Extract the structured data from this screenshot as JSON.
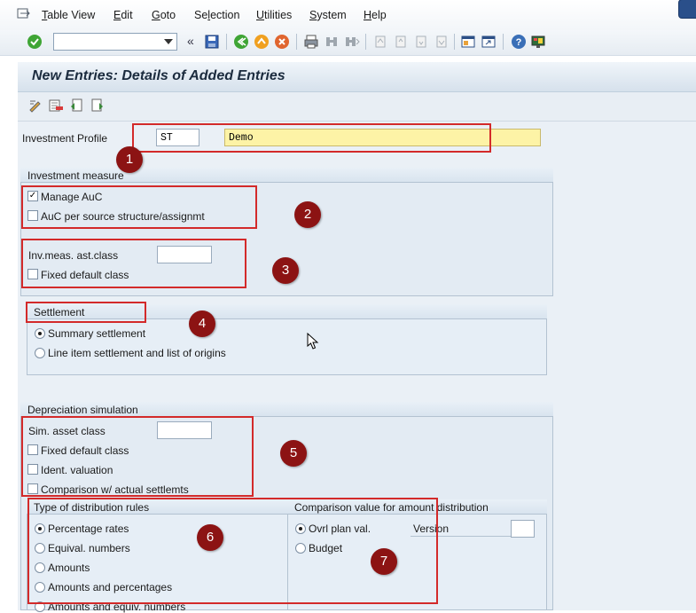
{
  "menu": {
    "items": [
      {
        "label": "Table View",
        "name": "menu-table-view"
      },
      {
        "label": "Edit",
        "name": "menu-edit"
      },
      {
        "label": "Goto",
        "name": "menu-goto"
      },
      {
        "label": "Selection",
        "name": "menu-selection"
      },
      {
        "label": "Utilities",
        "name": "menu-utilities"
      },
      {
        "label": "System",
        "name": "menu-system"
      },
      {
        "label": "Help",
        "name": "menu-help"
      }
    ]
  },
  "toolbar": {
    "command_field_value": "",
    "back_arrows": "«"
  },
  "page": {
    "title": "New Entries: Details of Added Entries"
  },
  "investment_profile": {
    "label": "Investment Profile",
    "code": "ST",
    "description": "Demo"
  },
  "investment_measure": {
    "title": "Investment measure",
    "manage_auc": {
      "label": "Manage AuC",
      "checked": true
    },
    "auc_per_source": {
      "label": "AuC per source structure/assignmt",
      "checked": false
    },
    "ast_class_label": "Inv.meas. ast.class",
    "ast_class_value": "",
    "fixed_default_class": {
      "label": "Fixed default class",
      "checked": false
    }
  },
  "settlement": {
    "title": "Settlement",
    "options": [
      {
        "label": "Summary settlement",
        "selected": true
      },
      {
        "label": "Line item settlement and list of origins",
        "selected": false
      }
    ]
  },
  "depreciation_simulation": {
    "title": "Depreciation simulation",
    "sim_asset_class_label": "Sim. asset class",
    "sim_asset_class_value": "",
    "fixed_default_class": {
      "label": "Fixed default class",
      "checked": false
    },
    "ident_valuation": {
      "label": "Ident. valuation",
      "checked": false
    },
    "comparison_actual": {
      "label": "Comparison w/ actual settlemts",
      "checked": false
    }
  },
  "distribution_rules": {
    "title": "Type of distribution rules",
    "options": [
      {
        "label": "Percentage rates",
        "selected": true
      },
      {
        "label": "Equival. numbers",
        "selected": false
      },
      {
        "label": "Amounts",
        "selected": false
      },
      {
        "label": "Amounts and percentages",
        "selected": false
      },
      {
        "label": "Amounts and equiv. numbers",
        "selected": false
      }
    ]
  },
  "comparison_value": {
    "title": "Comparison value for amount distribution",
    "options": [
      {
        "label": "Ovrl plan val.",
        "selected": true
      },
      {
        "label": "Budget",
        "selected": false
      }
    ],
    "version_label": "Version",
    "version_value": ""
  },
  "markers": [
    "1",
    "2",
    "3",
    "4",
    "5",
    "6",
    "7"
  ],
  "colors": {
    "annotation_red": "#d32a2a",
    "marker_fill": "#8c1313",
    "highlight_yellow": "#fdf3a6"
  }
}
